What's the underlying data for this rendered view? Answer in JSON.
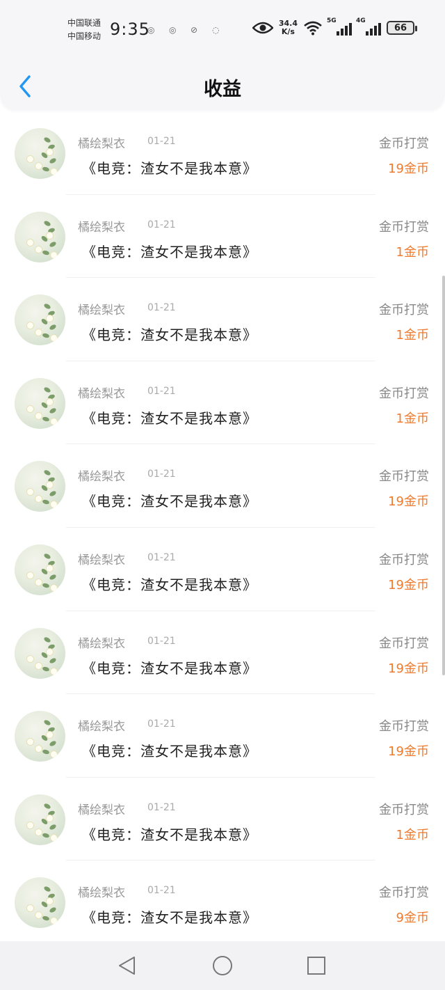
{
  "status_bar": {
    "carrier1": "中国联通",
    "carrier2": "中国移动",
    "time": "9:35",
    "net_speed_value": "34.4",
    "net_speed_unit": "K/s",
    "sig1_label": "5G",
    "sig2_label": "4G",
    "battery": "66"
  },
  "header": {
    "title": "收益",
    "back_icon": "chevron-left-icon"
  },
  "list": [
    {
      "name": "橘绘梨衣",
      "date": "01-21",
      "book": "《电竞：渣女不是我本意》",
      "type": "金币打赏",
      "amount": "19金币"
    },
    {
      "name": "橘绘梨衣",
      "date": "01-21",
      "book": "《电竞：渣女不是我本意》",
      "type": "金币打赏",
      "amount": "1金币"
    },
    {
      "name": "橘绘梨衣",
      "date": "01-21",
      "book": "《电竞：渣女不是我本意》",
      "type": "金币打赏",
      "amount": "1金币"
    },
    {
      "name": "橘绘梨衣",
      "date": "01-21",
      "book": "《电竞：渣女不是我本意》",
      "type": "金币打赏",
      "amount": "1金币"
    },
    {
      "name": "橘绘梨衣",
      "date": "01-21",
      "book": "《电竞：渣女不是我本意》",
      "type": "金币打赏",
      "amount": "19金币"
    },
    {
      "name": "橘绘梨衣",
      "date": "01-21",
      "book": "《电竞：渣女不是我本意》",
      "type": "金币打赏",
      "amount": "19金币"
    },
    {
      "name": "橘绘梨衣",
      "date": "01-21",
      "book": "《电竞：渣女不是我本意》",
      "type": "金币打赏",
      "amount": "19金币"
    },
    {
      "name": "橘绘梨衣",
      "date": "01-21",
      "book": "《电竞：渣女不是我本意》",
      "type": "金币打赏",
      "amount": "19金币"
    },
    {
      "name": "橘绘梨衣",
      "date": "01-21",
      "book": "《电竞：渣女不是我本意》",
      "type": "金币打赏",
      "amount": "1金币"
    },
    {
      "name": "橘绘梨衣",
      "date": "01-21",
      "book": "《电竞：渣女不是我本意》",
      "type": "金币打赏",
      "amount": "9金币"
    }
  ],
  "colors": {
    "accent_back": "#2196f3",
    "amount": "#f07a2e"
  },
  "nav_bar": {
    "back": "triangle-back-icon",
    "home": "circle-home-icon",
    "recents": "square-recents-icon"
  }
}
